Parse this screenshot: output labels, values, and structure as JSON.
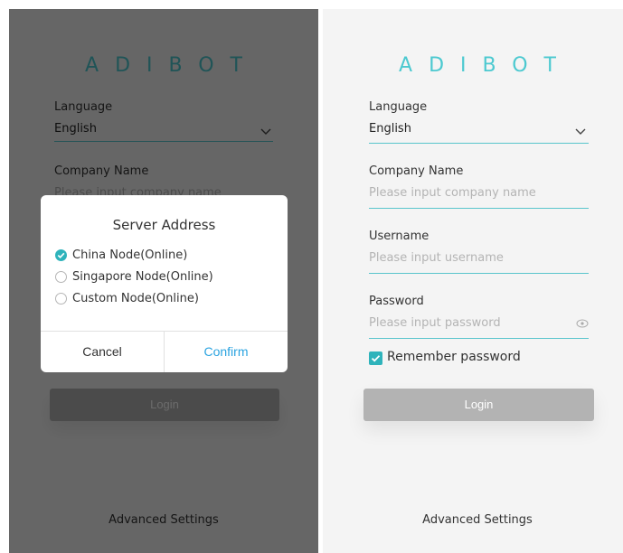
{
  "app": {
    "logo": "ADIBOT"
  },
  "form": {
    "language_label": "Language",
    "language_value": "English",
    "company_label": "Company Name",
    "company_placeholder": "Please input company name",
    "username_label": "Username",
    "username_placeholder": "Please input username",
    "password_label": "Password",
    "password_placeholder": "Please input password",
    "remember_label": "Remember password",
    "remember_checked": true,
    "login_label": "Login",
    "advanced_label": "Advanced Settings"
  },
  "dialog": {
    "title": "Server Address",
    "options": [
      {
        "label": "China Node(Online)",
        "selected": true
      },
      {
        "label": "Singapore Node(Online)",
        "selected": false
      },
      {
        "label": "Custom Node(Online)",
        "selected": false
      }
    ],
    "cancel_label": "Cancel",
    "confirm_label": "Confirm"
  },
  "colors": {
    "accent": "#2fb3bb",
    "logo": "#4cc9d0",
    "confirm": "#2aa3e0",
    "button_disabled": "#b3b3b3"
  }
}
